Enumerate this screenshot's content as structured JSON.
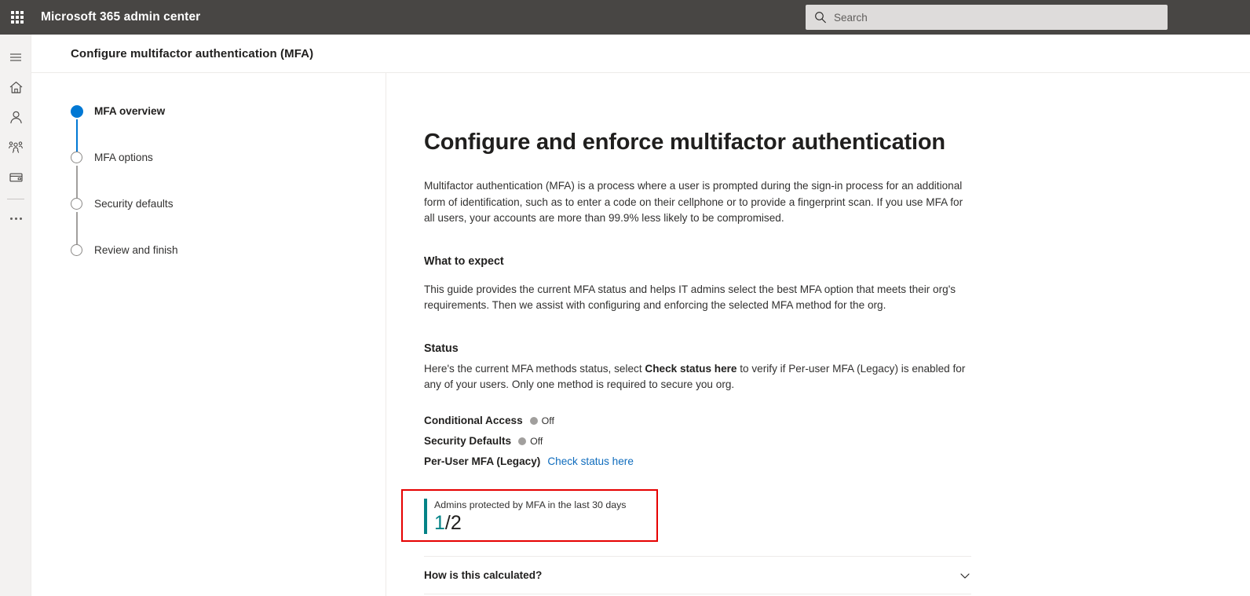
{
  "suite": {
    "title": "Microsoft 365 admin center",
    "waffle_icon": "app-launcher-waffle-icon",
    "search": {
      "placeholder": "Search",
      "value": "",
      "icon": "search-icon"
    },
    "bar_color": "#484644"
  },
  "rail": {
    "items": [
      {
        "icon": "hamburger-menu-icon",
        "name": "menu"
      },
      {
        "icon": "home-icon",
        "name": "home"
      },
      {
        "icon": "person-icon",
        "name": "users"
      },
      {
        "icon": "people-group-icon",
        "name": "teams-groups"
      },
      {
        "icon": "billing-card-icon",
        "name": "billing"
      }
    ],
    "overflow_icon": "ellipsis-icon"
  },
  "page": {
    "title": "Configure multifactor authentication (MFA)"
  },
  "stepper": {
    "steps": [
      {
        "label": "MFA overview",
        "state": "current"
      },
      {
        "label": "MFA options",
        "state": "upcoming"
      },
      {
        "label": "Security defaults",
        "state": "upcoming"
      },
      {
        "label": "Review and finish",
        "state": "upcoming"
      }
    ],
    "active_color": "#0078d4"
  },
  "main": {
    "heading": "Configure and enforce multifactor authentication",
    "intro": "Multifactor authentication (MFA) is a process where a user is prompted during the sign-in process for an additional form of identification, such as to enter a code on their cellphone or to provide a fingerprint scan. If you use MFA for all users, your accounts are more than 99.9% less likely to be compromised.",
    "what_to_expect": {
      "heading": "What to expect",
      "body": "This guide provides the current MFA status and helps IT admins select the best MFA option that meets their org's requirements. Then we assist with configuring and enforcing the selected MFA method for the org."
    },
    "status": {
      "heading": "Status",
      "description_part1": "Here's the current MFA methods status, select ",
      "description_bold": "Check status here",
      "description_part2": " to verify if Per-user MFA (Legacy) is enabled for any of your users. Only one method is required to secure you org.",
      "rows": [
        {
          "name": "Conditional Access",
          "value": "Off",
          "type": "dot",
          "dot_color": "#a19f9d"
        },
        {
          "name": "Security Defaults",
          "value": "Off",
          "type": "dot",
          "dot_color": "#a19f9d"
        },
        {
          "name": "Per-User MFA (Legacy)",
          "value": "Check status here",
          "type": "link",
          "link_color": "#0f6cbd"
        }
      ]
    },
    "metric": {
      "label": "Admins protected by MFA in the last 30 days",
      "numerator": "1",
      "denominator": "/2",
      "accent_color": "#038387",
      "highlight_color": "#e60000"
    },
    "collapsible": {
      "label": "How is this calculated?",
      "icon": "chevron-down-icon",
      "expanded": false
    }
  }
}
